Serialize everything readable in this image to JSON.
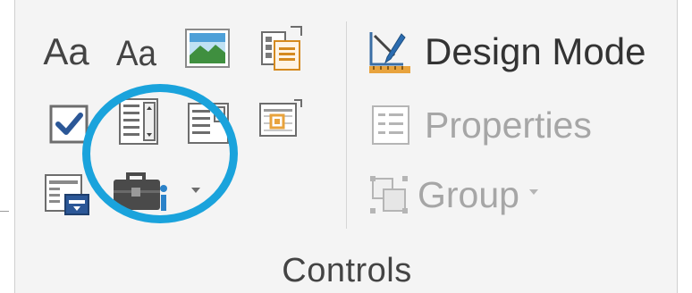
{
  "controls_group": {
    "label": "Controls",
    "rich_text_control": {
      "text": "Aa",
      "icon": "rich-text-content-control-icon"
    },
    "plain_text_control": {
      "text": "Aa",
      "icon": "plain-text-content-control-icon"
    },
    "picture_control": {
      "icon": "picture-content-control-icon"
    },
    "building_block_control": {
      "icon": "building-block-gallery-control-icon"
    },
    "checkbox_control": {
      "icon": "checkbox-content-control-icon"
    },
    "combo_box_control": {
      "icon": "combo-box-content-control-icon"
    },
    "dropdown_list_control": {
      "icon": "drop-down-list-content-control-icon"
    },
    "date_picker_control": {
      "icon": "date-picker-content-control-icon"
    },
    "repeating_section_control": {
      "icon": "repeating-section-content-control-icon"
    },
    "legacy_tools": {
      "icon": "legacy-tools-icon",
      "has_dropdown": true
    },
    "design_mode": {
      "label": "Design Mode",
      "icon": "design-mode-icon",
      "enabled": true
    },
    "properties": {
      "label": "Properties",
      "icon": "properties-icon",
      "enabled": false
    },
    "group": {
      "label": "Group",
      "icon": "group-icon",
      "enabled": false,
      "has_dropdown": true
    }
  },
  "annotation": {
    "shape": "circle",
    "color": "#1aa3dc",
    "highlights": "legacy_tools"
  },
  "colors": {
    "background": "#f4f4f4",
    "text": "#444444",
    "text_disabled": "#a6a6a6",
    "checkbox_blue": "#2b5797",
    "accent_orange": "#e8a33d"
  }
}
